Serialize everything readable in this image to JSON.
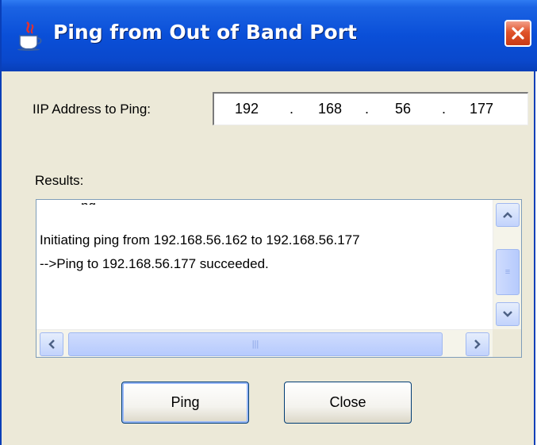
{
  "window": {
    "title": "Ping from Out of Band Port",
    "title_icon": "java-icon",
    "close_icon": "close-icon"
  },
  "form": {
    "ip_label": "IIP Address to Ping:",
    "ip_octets": [
      "192",
      "168",
      "56",
      "177"
    ],
    "ip_separator": "."
  },
  "results": {
    "label": "Results:",
    "lines": [
      "Initiating ping from 192.168.56.162 to 192.168.56.177",
      "-->Ping to 192.168.56.177 succeeded."
    ],
    "partial_line": "ng"
  },
  "buttons": {
    "ping_label": "Ping",
    "close_label": "Close"
  },
  "colors": {
    "titlebar": "#0a4fd8",
    "dialog_bg": "#ece9d8",
    "button_border": "#003c74",
    "scroll_thumb": "#c2d3fc"
  }
}
